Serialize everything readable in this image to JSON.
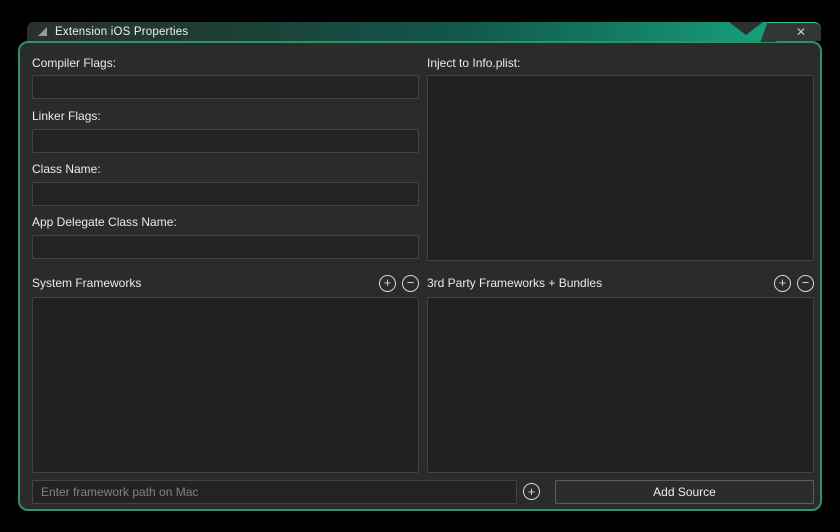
{
  "window": {
    "title": "Extension iOS Properties",
    "close_icon": "✕"
  },
  "left_form": {
    "fields": [
      {
        "label": "Compiler Flags:",
        "value": ""
      },
      {
        "label": "Linker Flags:",
        "value": ""
      },
      {
        "label": "Class Name:",
        "value": ""
      },
      {
        "label": "App Delegate Class Name:",
        "value": ""
      }
    ]
  },
  "info_plist": {
    "label": "Inject to Info.plist:",
    "value": ""
  },
  "system_frameworks": {
    "label": "System Frameworks",
    "add_icon": "+",
    "remove_icon": "−",
    "items": []
  },
  "third_party_frameworks": {
    "label": "3rd Party Frameworks + Bundles",
    "add_icon": "+",
    "remove_icon": "−",
    "items": []
  },
  "footer": {
    "path_placeholder": "Enter framework path on Mac",
    "path_value": "",
    "add_icon": "+",
    "add_source_label": "Add Source"
  },
  "colors": {
    "accent_teal": "#1aa67f",
    "panel_border_green": "#2f9268",
    "panel_bg": "#2a2b2b",
    "field_bg": "#232324",
    "box_bg": "#202122"
  }
}
